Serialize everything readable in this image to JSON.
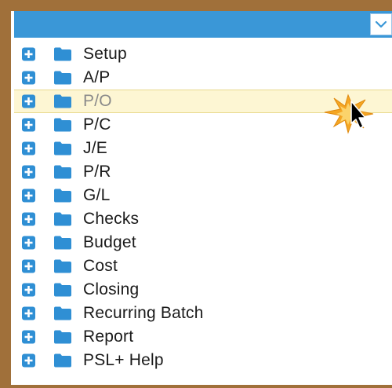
{
  "header": {
    "dropdown_icon": "chevron-down-icon"
  },
  "tree": {
    "items": [
      {
        "label": "Setup",
        "icon": "folder-icon",
        "expander": "plus-icon",
        "state": "normal"
      },
      {
        "label": "A/P",
        "icon": "folder-icon",
        "expander": "plus-icon",
        "state": "normal"
      },
      {
        "label": "P/O",
        "icon": "folder-icon",
        "expander": "plus-icon",
        "state": "hovered"
      },
      {
        "label": "P/C",
        "icon": "folder-icon",
        "expander": "plus-icon",
        "state": "normal"
      },
      {
        "label": "J/E",
        "icon": "folder-icon",
        "expander": "plus-icon",
        "state": "normal"
      },
      {
        "label": "P/R",
        "icon": "folder-icon",
        "expander": "plus-icon",
        "state": "normal"
      },
      {
        "label": "G/L",
        "icon": "folder-icon",
        "expander": "plus-icon",
        "state": "normal"
      },
      {
        "label": "Checks",
        "icon": "folder-icon",
        "expander": "plus-icon",
        "state": "normal"
      },
      {
        "label": "Budget",
        "icon": "folder-icon",
        "expander": "plus-icon",
        "state": "normal"
      },
      {
        "label": "Cost",
        "icon": "folder-icon",
        "expander": "plus-icon",
        "state": "normal"
      },
      {
        "label": "Closing",
        "icon": "folder-icon",
        "expander": "plus-icon",
        "state": "normal"
      },
      {
        "label": "Recurring Batch",
        "icon": "folder-icon",
        "expander": "plus-icon",
        "state": "normal"
      },
      {
        "label": "Report",
        "icon": "folder-icon",
        "expander": "plus-icon",
        "state": "normal"
      },
      {
        "label": "PSL+ Help",
        "icon": "folder-icon",
        "expander": "plus-icon",
        "state": "normal"
      }
    ]
  },
  "colors": {
    "frame": "#a0703a",
    "header": "#3a97d7",
    "icon_blue": "#2f8fd4",
    "hover_bg": "#fdf6d3",
    "click_burst": "#f5a623"
  },
  "pointer": {
    "icon": "mouse-pointer-icon",
    "effect": "click-burst-icon"
  }
}
